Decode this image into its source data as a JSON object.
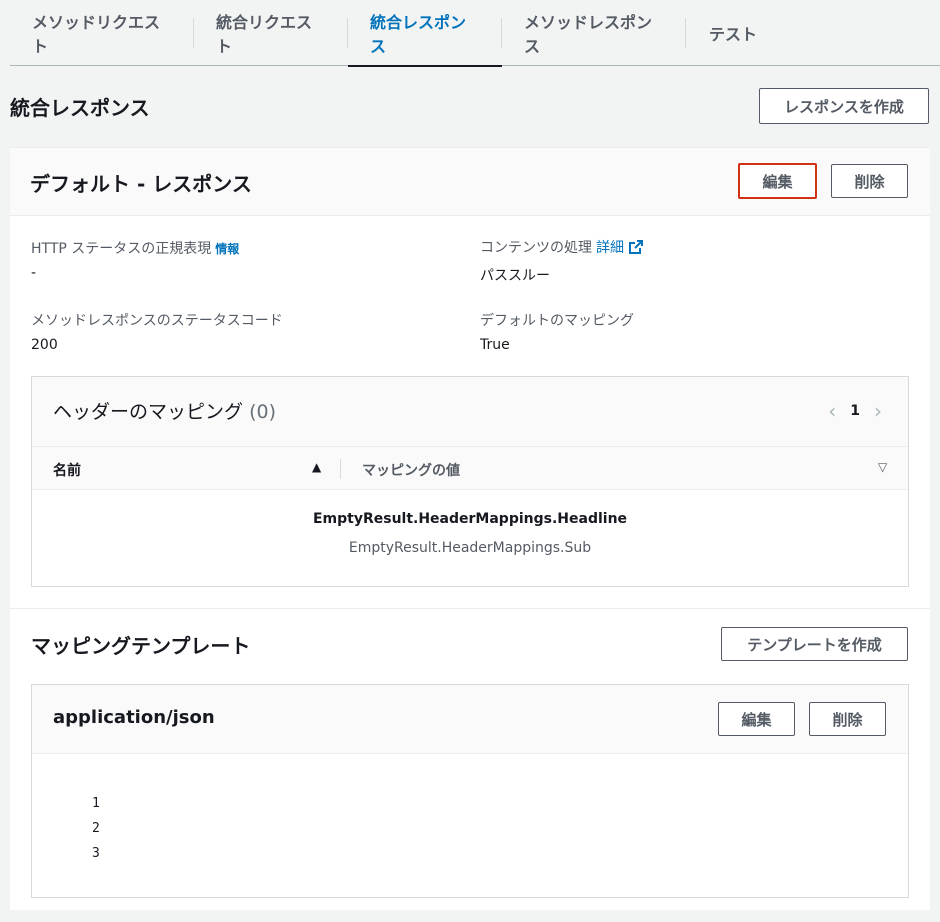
{
  "tabs": [
    {
      "label": "メソッドリクエスト"
    },
    {
      "label": "統合リクエスト"
    },
    {
      "label": "統合レスポンス"
    },
    {
      "label": "メソッドレスポンス"
    },
    {
      "label": "テスト"
    }
  ],
  "active_tab": "統合レスポンス",
  "section": {
    "title": "統合レスポンス",
    "create_button": "レスポンスを作成"
  },
  "response": {
    "title": "デフォルト - レスポンス",
    "edit_button": "編集",
    "delete_button": "削除",
    "http_status_regex_label": "HTTP ステータスの正規表現",
    "info_link": "情報",
    "http_status_regex_value": "-",
    "content_handling_label": "コンテンツの処理",
    "details_link": "詳細",
    "content_handling_value": "パススルー",
    "method_status_code_label": "メソッドレスポンスのステータスコード",
    "method_status_code_value": "200",
    "default_mapping_label": "デフォルトのマッピング",
    "default_mapping_value": "True"
  },
  "header_mappings": {
    "title": "ヘッダーのマッピング",
    "count": "(0)",
    "page": "1",
    "column_name": "名前",
    "column_value": "マッピングの値",
    "empty_headline": "EmptyResult.HeaderMappings.Headline",
    "empty_sub": "EmptyResult.HeaderMappings.Sub"
  },
  "templates": {
    "title": "マッピングテンプレート",
    "create_button": "テンプレートを作成",
    "content_type": "application/json",
    "edit_button": "編集",
    "delete_button": "削除",
    "line_numbers": [
      "1",
      "2",
      "3"
    ]
  },
  "colors": {
    "accent": "#0073bb",
    "highlight_border": "#d13212"
  }
}
